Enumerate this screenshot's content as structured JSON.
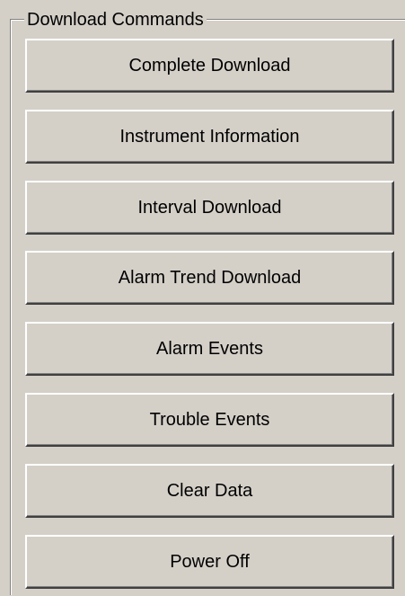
{
  "group": {
    "title": "Download Commands"
  },
  "buttons": [
    {
      "label": "Complete Download"
    },
    {
      "label": "Instrument Information"
    },
    {
      "label": "Interval Download"
    },
    {
      "label": "Alarm Trend Download"
    },
    {
      "label": "Alarm Events"
    },
    {
      "label": "Trouble Events"
    },
    {
      "label": "Clear Data"
    },
    {
      "label": "Power Off"
    }
  ],
  "colors": {
    "face": "#d4d0c8",
    "highlight": "#ffffff",
    "shadow": "#808080",
    "dark_shadow": "#404040",
    "text": "#000000"
  }
}
